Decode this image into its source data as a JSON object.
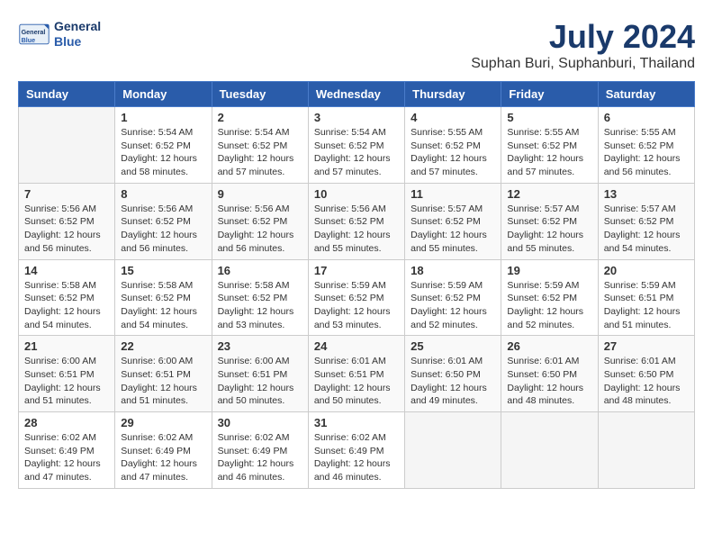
{
  "header": {
    "logo_line1": "General",
    "logo_line2": "Blue",
    "month_year": "July 2024",
    "location": "Suphan Buri, Suphanburi, Thailand"
  },
  "weekdays": [
    "Sunday",
    "Monday",
    "Tuesday",
    "Wednesday",
    "Thursday",
    "Friday",
    "Saturday"
  ],
  "weeks": [
    [
      {
        "day": "",
        "info": ""
      },
      {
        "day": "1",
        "info": "Sunrise: 5:54 AM\nSunset: 6:52 PM\nDaylight: 12 hours\nand 58 minutes."
      },
      {
        "day": "2",
        "info": "Sunrise: 5:54 AM\nSunset: 6:52 PM\nDaylight: 12 hours\nand 57 minutes."
      },
      {
        "day": "3",
        "info": "Sunrise: 5:54 AM\nSunset: 6:52 PM\nDaylight: 12 hours\nand 57 minutes."
      },
      {
        "day": "4",
        "info": "Sunrise: 5:55 AM\nSunset: 6:52 PM\nDaylight: 12 hours\nand 57 minutes."
      },
      {
        "day": "5",
        "info": "Sunrise: 5:55 AM\nSunset: 6:52 PM\nDaylight: 12 hours\nand 57 minutes."
      },
      {
        "day": "6",
        "info": "Sunrise: 5:55 AM\nSunset: 6:52 PM\nDaylight: 12 hours\nand 56 minutes."
      }
    ],
    [
      {
        "day": "7",
        "info": "Sunrise: 5:56 AM\nSunset: 6:52 PM\nDaylight: 12 hours\nand 56 minutes."
      },
      {
        "day": "8",
        "info": "Sunrise: 5:56 AM\nSunset: 6:52 PM\nDaylight: 12 hours\nand 56 minutes."
      },
      {
        "day": "9",
        "info": "Sunrise: 5:56 AM\nSunset: 6:52 PM\nDaylight: 12 hours\nand 56 minutes."
      },
      {
        "day": "10",
        "info": "Sunrise: 5:56 AM\nSunset: 6:52 PM\nDaylight: 12 hours\nand 55 minutes."
      },
      {
        "day": "11",
        "info": "Sunrise: 5:57 AM\nSunset: 6:52 PM\nDaylight: 12 hours\nand 55 minutes."
      },
      {
        "day": "12",
        "info": "Sunrise: 5:57 AM\nSunset: 6:52 PM\nDaylight: 12 hours\nand 55 minutes."
      },
      {
        "day": "13",
        "info": "Sunrise: 5:57 AM\nSunset: 6:52 PM\nDaylight: 12 hours\nand 54 minutes."
      }
    ],
    [
      {
        "day": "14",
        "info": "Sunrise: 5:58 AM\nSunset: 6:52 PM\nDaylight: 12 hours\nand 54 minutes."
      },
      {
        "day": "15",
        "info": "Sunrise: 5:58 AM\nSunset: 6:52 PM\nDaylight: 12 hours\nand 54 minutes."
      },
      {
        "day": "16",
        "info": "Sunrise: 5:58 AM\nSunset: 6:52 PM\nDaylight: 12 hours\nand 53 minutes."
      },
      {
        "day": "17",
        "info": "Sunrise: 5:59 AM\nSunset: 6:52 PM\nDaylight: 12 hours\nand 53 minutes."
      },
      {
        "day": "18",
        "info": "Sunrise: 5:59 AM\nSunset: 6:52 PM\nDaylight: 12 hours\nand 52 minutes."
      },
      {
        "day": "19",
        "info": "Sunrise: 5:59 AM\nSunset: 6:52 PM\nDaylight: 12 hours\nand 52 minutes."
      },
      {
        "day": "20",
        "info": "Sunrise: 5:59 AM\nSunset: 6:51 PM\nDaylight: 12 hours\nand 51 minutes."
      }
    ],
    [
      {
        "day": "21",
        "info": "Sunrise: 6:00 AM\nSunset: 6:51 PM\nDaylight: 12 hours\nand 51 minutes."
      },
      {
        "day": "22",
        "info": "Sunrise: 6:00 AM\nSunset: 6:51 PM\nDaylight: 12 hours\nand 51 minutes."
      },
      {
        "day": "23",
        "info": "Sunrise: 6:00 AM\nSunset: 6:51 PM\nDaylight: 12 hours\nand 50 minutes."
      },
      {
        "day": "24",
        "info": "Sunrise: 6:01 AM\nSunset: 6:51 PM\nDaylight: 12 hours\nand 50 minutes."
      },
      {
        "day": "25",
        "info": "Sunrise: 6:01 AM\nSunset: 6:50 PM\nDaylight: 12 hours\nand 49 minutes."
      },
      {
        "day": "26",
        "info": "Sunrise: 6:01 AM\nSunset: 6:50 PM\nDaylight: 12 hours\nand 48 minutes."
      },
      {
        "day": "27",
        "info": "Sunrise: 6:01 AM\nSunset: 6:50 PM\nDaylight: 12 hours\nand 48 minutes."
      }
    ],
    [
      {
        "day": "28",
        "info": "Sunrise: 6:02 AM\nSunset: 6:49 PM\nDaylight: 12 hours\nand 47 minutes."
      },
      {
        "day": "29",
        "info": "Sunrise: 6:02 AM\nSunset: 6:49 PM\nDaylight: 12 hours\nand 47 minutes."
      },
      {
        "day": "30",
        "info": "Sunrise: 6:02 AM\nSunset: 6:49 PM\nDaylight: 12 hours\nand 46 minutes."
      },
      {
        "day": "31",
        "info": "Sunrise: 6:02 AM\nSunset: 6:49 PM\nDaylight: 12 hours\nand 46 minutes."
      },
      {
        "day": "",
        "info": ""
      },
      {
        "day": "",
        "info": ""
      },
      {
        "day": "",
        "info": ""
      }
    ]
  ]
}
